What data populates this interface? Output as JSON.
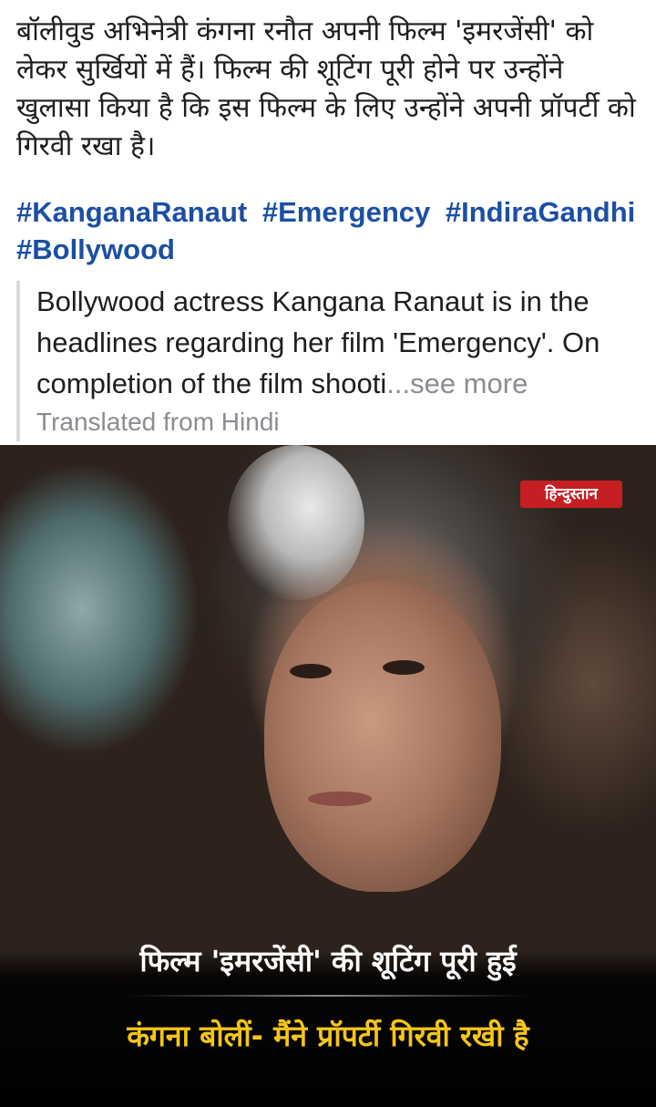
{
  "post": {
    "text": "बॉलीवुड अभिनेत्री कंगना रनौत अपनी फिल्म 'इमरजेंसी' को लेकर सुर्खियों में हैं। फिल्म की शूटिंग पूरी होने पर उन्होंने खुलासा किया है कि इस फिल्म के लिए उन्होंने अपनी प्रॉपर्टी को गिरवी रखा है।",
    "hashtags": [
      "#KanganaRanaut",
      "#Emergency",
      "#IndiraGandhi",
      "#Bollywood"
    ]
  },
  "translation": {
    "text": "Bollywood actress Kangana Ranaut is in the headlines regarding her film 'Emergency'. On completion of the film shooti",
    "see_more": "...see more",
    "from_label": "Translated from Hindi"
  },
  "photo": {
    "brand": "हिन्दुस्तान",
    "caption_line1": "फिल्म 'इमरजेंसी' की शूटिंग पूरी हुई",
    "caption_line2": "कंगना बोलीं- मैंने प्रॉपर्टी गिरवी रखी है",
    "caption_line1_color": "#ffffff",
    "caption_line2_color": "#f5c518",
    "brand_color": "#c51f24"
  },
  "colors": {
    "hashtag": "#1b4fa3",
    "muted": "#8a8d91",
    "text": "#1c1e21"
  }
}
